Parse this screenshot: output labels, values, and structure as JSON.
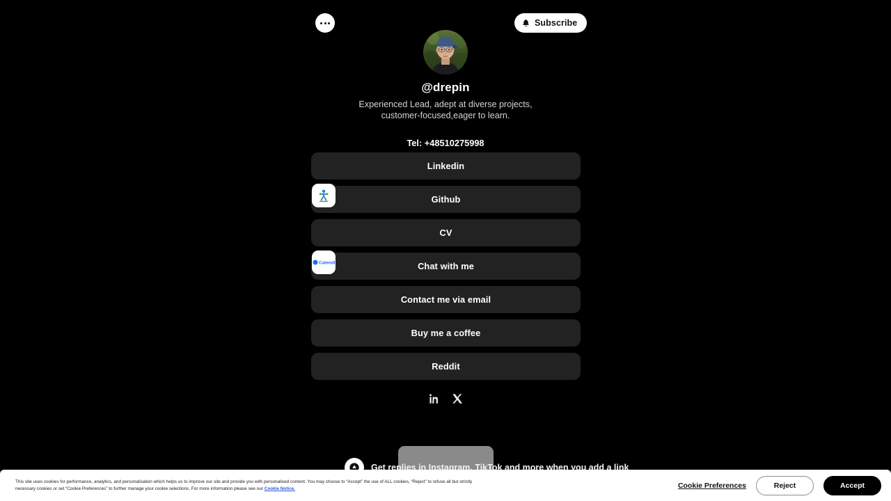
{
  "theme": {
    "page_background": "#000000",
    "link_button_background": "#222222",
    "link_text_color": "#ffffff",
    "bio_text_color": "#d4d4d4",
    "accent_link_color": "#2a5bd7",
    "banner_background": "#ffffff"
  },
  "topbar": {
    "more_button": {
      "icon": "ellipsis-icon",
      "label": ""
    },
    "subscribe_button": {
      "icon": "bell-icon",
      "label": "Subscribe"
    }
  },
  "profile": {
    "avatar_icon": "profile-photo",
    "handle": "@drepin",
    "bio": "Experienced Lead, adept at diverse projects, customer-focused,eager to learn.",
    "tel": "Tel: +48510275998"
  },
  "links": [
    {
      "label": "Linkedin",
      "thumbnail": null
    },
    {
      "label": "Github",
      "thumbnail": "github-thumbnail"
    },
    {
      "label": "CV",
      "thumbnail": null
    },
    {
      "label": "Chat with me",
      "thumbnail": "calendly-thumbnail"
    },
    {
      "label": "Contact me via email",
      "thumbnail": null
    },
    {
      "label": "Buy me a coffee",
      "thumbnail": null
    },
    {
      "label": "Reddit",
      "thumbnail": null
    }
  ],
  "socials": [
    {
      "name": "linkedin-icon",
      "label": "LinkedIn"
    },
    {
      "name": "x-icon",
      "label": "X"
    }
  ],
  "toast": {
    "icon": "info-icon",
    "text": "Get replies in Instagram, TikTok and more when you add a link"
  },
  "cookie_banner": {
    "text_part1": "This site uses cookies for performance, analytics, and personalisation which helps us to improve our site and provide you with personalised content. You may choose to “Accept” the use of ALL cookies, “Reject” to refuse all but strictly necessary cookies or set “Cookie Preferences” to further manage your cookie selections. For more information please see our ",
    "notice_link": "Cookie Notice.",
    "preferences_label": "Cookie Preferences",
    "reject_label": "Reject",
    "accept_label": "Accept"
  }
}
